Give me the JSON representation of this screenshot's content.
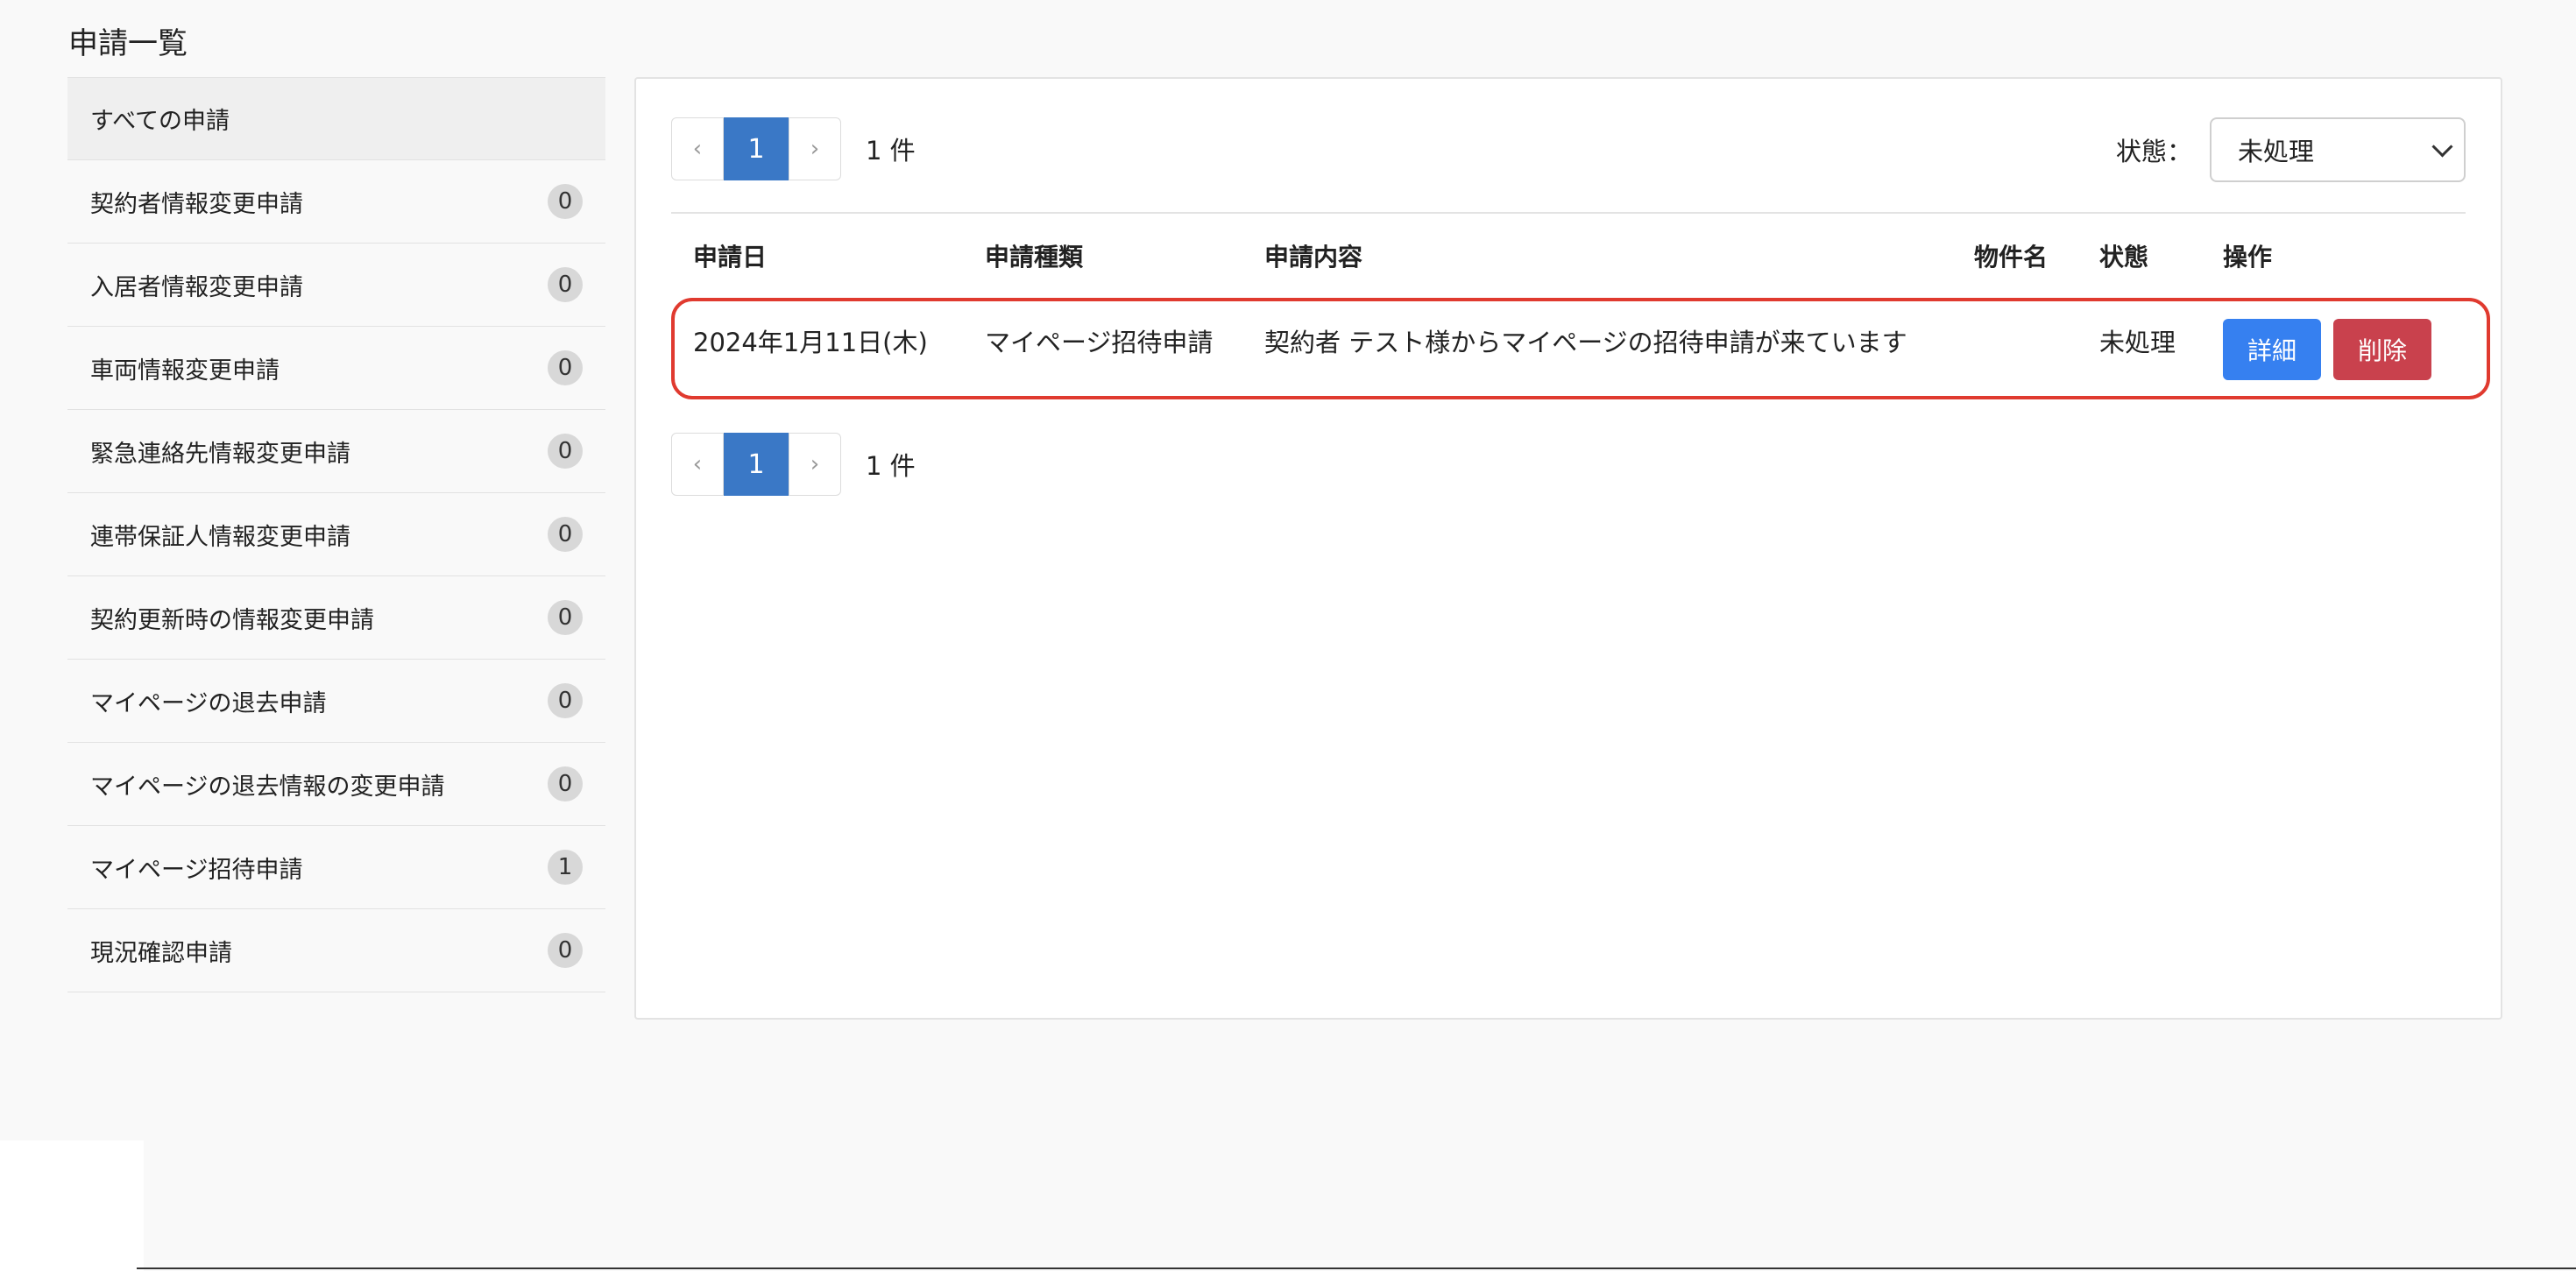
{
  "page": {
    "title": "申請一覧"
  },
  "sidebar": {
    "items": [
      {
        "label": "すべての申請",
        "count": ""
      },
      {
        "label": "契約者情報変更申請",
        "count": "0"
      },
      {
        "label": "入居者情報変更申請",
        "count": "0"
      },
      {
        "label": "車両情報変更申請",
        "count": "0"
      },
      {
        "label": "緊急連絡先情報変更申請",
        "count": "0"
      },
      {
        "label": "連帯保証人情報変更申請",
        "count": "0"
      },
      {
        "label": "契約更新時の情報変更申請",
        "count": "0"
      },
      {
        "label": "マイページの退去申請",
        "count": "0"
      },
      {
        "label": "マイページの退去情報の変更申請",
        "count": "0"
      },
      {
        "label": "マイページ招待申請",
        "count": "1"
      },
      {
        "label": "現況確認申請",
        "count": "0"
      }
    ]
  },
  "pagination": {
    "prev": "‹",
    "current": "1",
    "next": "›",
    "count_label": "1 件"
  },
  "filter": {
    "label": "状態：",
    "selected": "未処理"
  },
  "table": {
    "headers": {
      "date": "申請日",
      "type": "申請種類",
      "content": "申請内容",
      "property": "物件名",
      "status": "状態",
      "actions": "操作"
    },
    "rows": [
      {
        "date": "2024年1月11日(木)",
        "type": "マイページ招待申請",
        "content": "契約者 テスト様からマイページの招待申請が来ています",
        "property": "",
        "status": "未処理",
        "detail_label": "詳細",
        "delete_label": "削除"
      }
    ]
  },
  "colors": {
    "accent": "#3a78c6",
    "detail_button": "#3680f0",
    "delete_button": "#c9414d",
    "highlight": "#e03a2f"
  }
}
